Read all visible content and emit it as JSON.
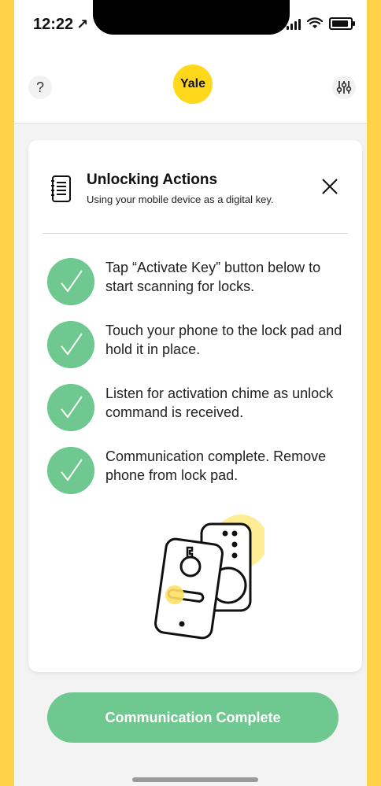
{
  "status_bar": {
    "time": "12:22",
    "location_arrow": "↗"
  },
  "header": {
    "help_label": "?",
    "logo_text": "Yale",
    "icons": {
      "help": "question-icon",
      "settings": "sliders-icon"
    }
  },
  "card": {
    "title": "Unlocking Actions",
    "subtitle": "Using your mobile device as a digital key.",
    "icons": {
      "doc": "document-list-icon",
      "close": "close-icon"
    },
    "steps": [
      {
        "text": "Tap “Activate Key” button below to start scanning for locks."
      },
      {
        "text": "Touch your phone to the lock pad and hold it in place."
      },
      {
        "text": "Listen for activation chime as unlock command is received."
      },
      {
        "text": "Communication complete. Remove phone from lock pad."
      }
    ],
    "illustration_icon": "phone-key-lock-illustration"
  },
  "cta": {
    "label": "Communication Complete"
  },
  "colors": {
    "accent": "#6fc88f",
    "brand_yellow": "#ffd81c",
    "background": "#ffd24a",
    "card": "#ffffff"
  }
}
